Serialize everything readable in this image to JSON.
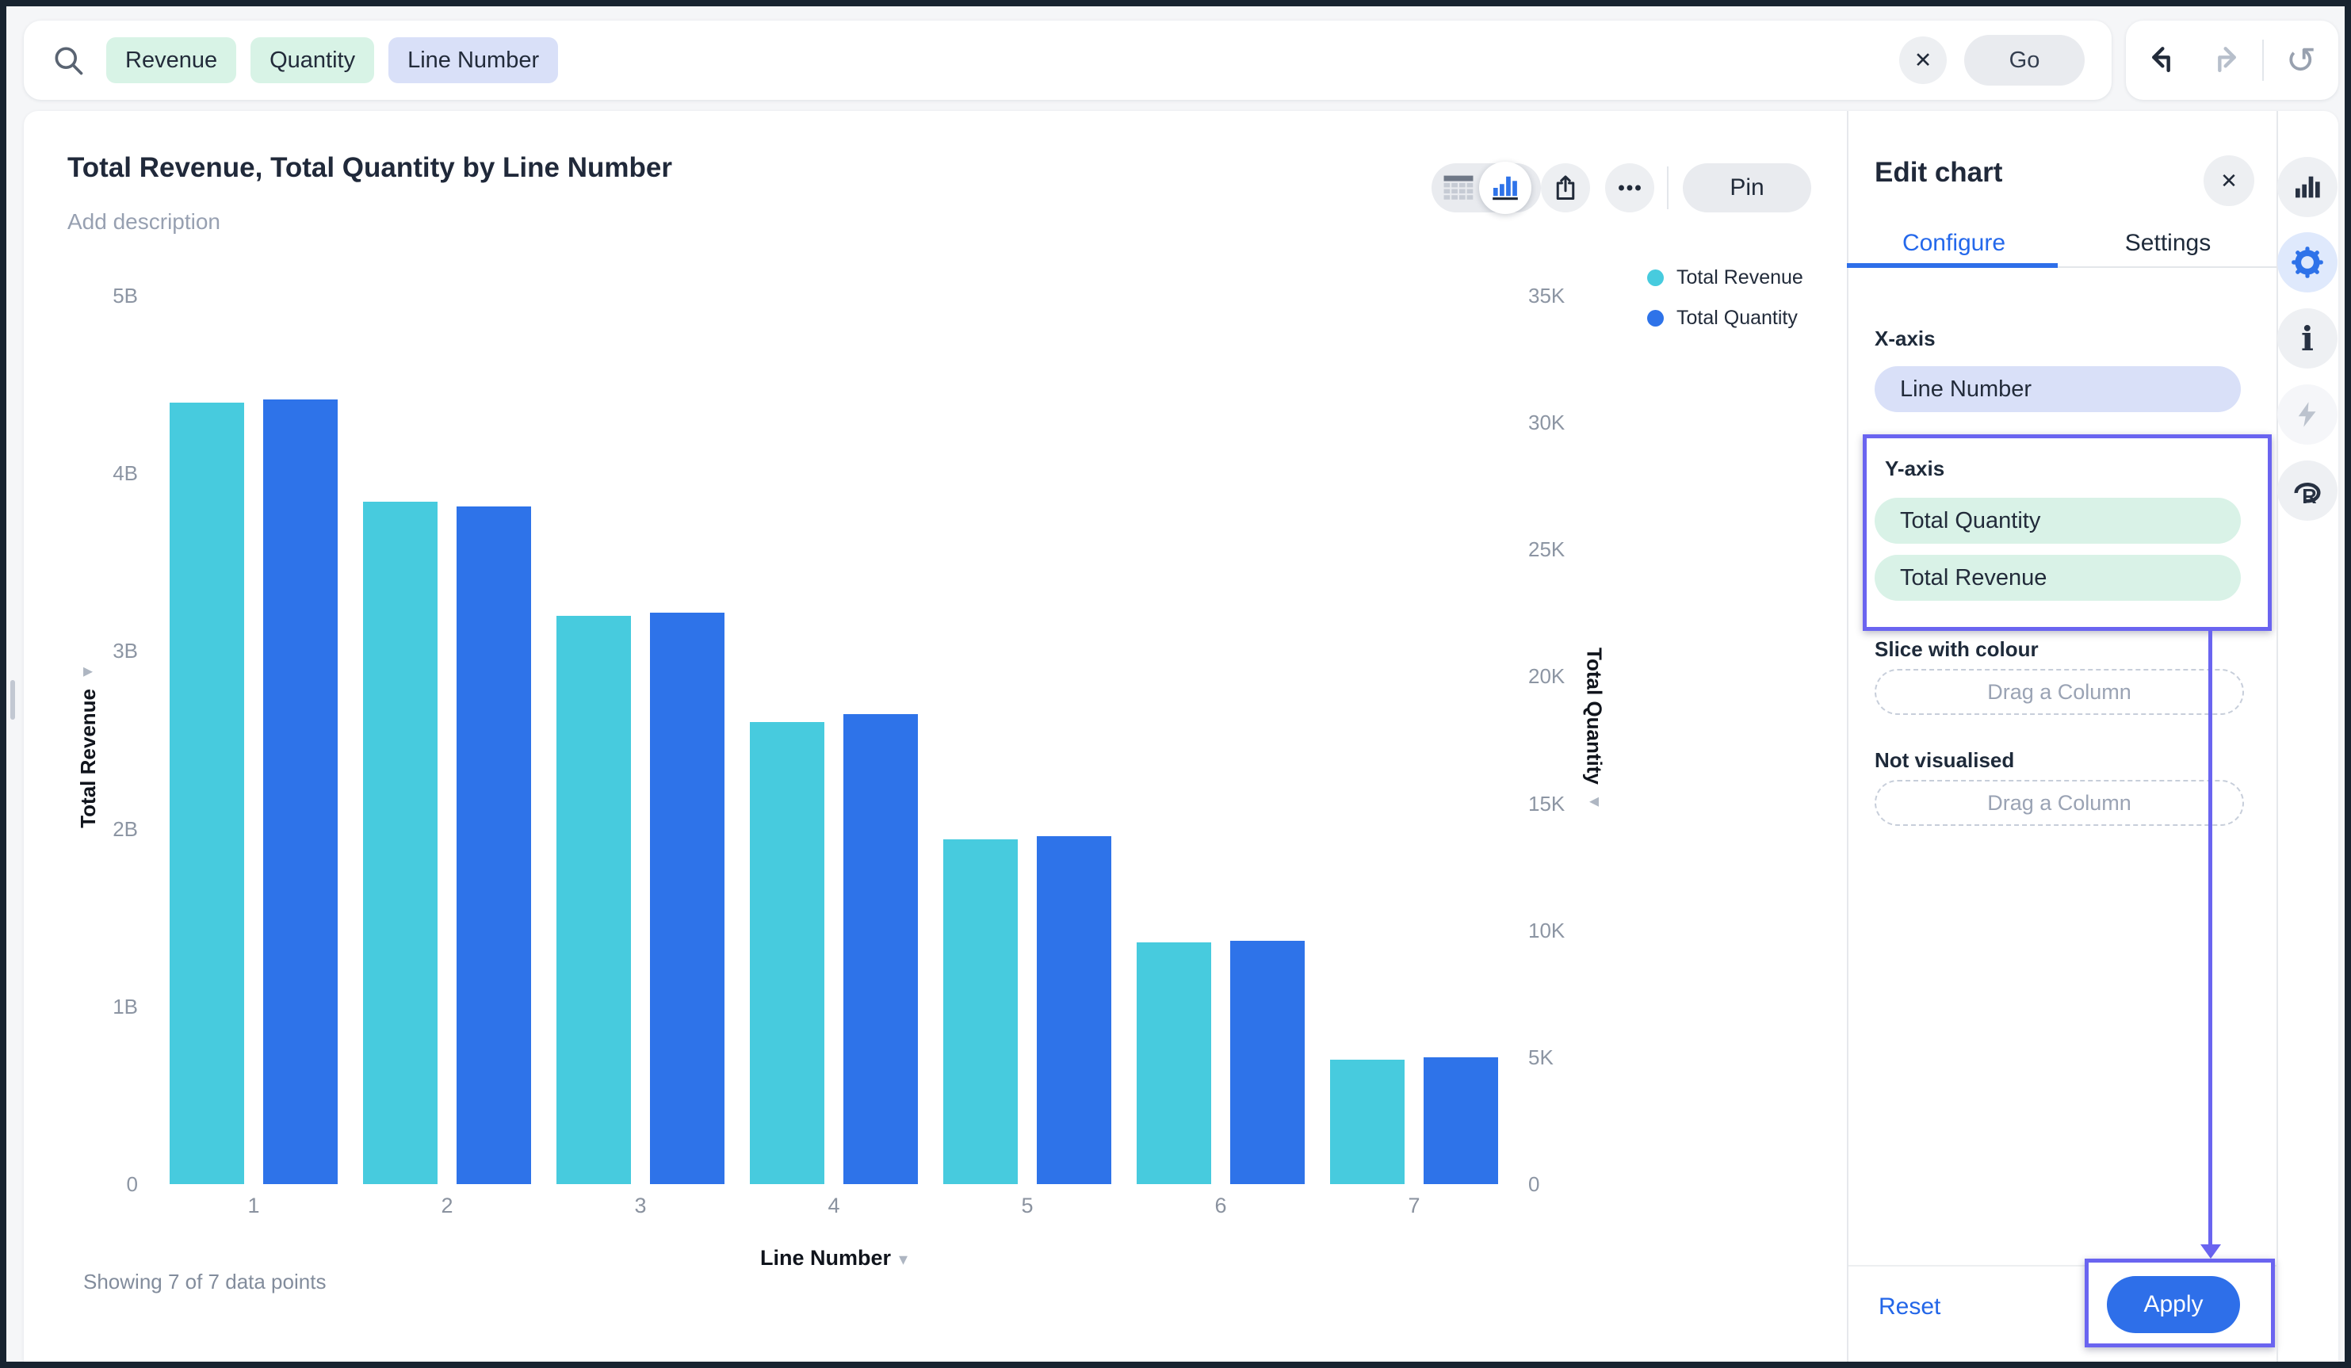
{
  "app": {
    "search": {
      "tokens": [
        {
          "label": "Revenue",
          "kind": "measure"
        },
        {
          "label": "Quantity",
          "kind": "measure"
        },
        {
          "label": "Line Number",
          "kind": "attribute"
        }
      ],
      "clear_label": "✕",
      "go_label": "Go"
    },
    "header": {
      "title": "Total Revenue, Total Quantity by Line Number",
      "description_placeholder": "Add description",
      "pin_label": "Pin"
    },
    "status": {
      "showing": "Showing 7 of 7 data points"
    }
  },
  "chart_data": {
    "type": "bar",
    "title": "Total Revenue, Total Quantity by Line Number",
    "categories": [
      "1",
      "2",
      "3",
      "4",
      "5",
      "6",
      "7"
    ],
    "series": [
      {
        "name": "Total Revenue",
        "axis": "left",
        "unit": "B",
        "color": "#47CBDE",
        "values": [
          4.4,
          3.84,
          3.2,
          2.6,
          1.94,
          1.36,
          0.7
        ]
      },
      {
        "name": "Total Quantity",
        "axis": "right",
        "unit": "K",
        "color": "#2E73E9",
        "values": [
          30.9,
          26.7,
          22.5,
          18.5,
          13.7,
          9.6,
          5.0
        ]
      }
    ],
    "left_axis": {
      "label": "Total Revenue",
      "min": 0,
      "max": 5,
      "ticks": [
        {
          "value": 5,
          "label": "5B"
        },
        {
          "value": 4,
          "label": "4B"
        },
        {
          "value": 3,
          "label": "3B"
        },
        {
          "value": 2,
          "label": "2B"
        },
        {
          "value": 1,
          "label": "1B"
        },
        {
          "value": 0,
          "label": "0"
        }
      ]
    },
    "right_axis": {
      "label": "Total Quantity",
      "min": 0,
      "max": 35,
      "ticks": [
        {
          "value": 35,
          "label": "35K"
        },
        {
          "value": 30,
          "label": "30K"
        },
        {
          "value": 25,
          "label": "25K"
        },
        {
          "value": 20,
          "label": "20K"
        },
        {
          "value": 15,
          "label": "15K"
        },
        {
          "value": 10,
          "label": "10K"
        },
        {
          "value": 5,
          "label": "5K"
        },
        {
          "value": 0,
          "label": "0"
        }
      ]
    },
    "xlabel": "Line Number",
    "legend_position": "top-right",
    "grid": false
  },
  "edit_panel": {
    "title": "Edit chart",
    "tabs": {
      "configure": "Configure",
      "settings": "Settings",
      "active": "Configure"
    },
    "x_axis": {
      "label": "X-axis",
      "field": "Line Number"
    },
    "y_axis": {
      "label": "Y-axis",
      "fields": [
        "Total Quantity",
        "Total Revenue"
      ]
    },
    "slice": {
      "label": "Slice with colour",
      "placeholder": "Drag a Column"
    },
    "not_visualised": {
      "label": "Not visualised",
      "placeholder": "Drag a Column"
    },
    "reset_label": "Reset",
    "apply_label": "Apply"
  },
  "icons": {
    "close": "✕",
    "history": "↺",
    "triangle_down": "▾",
    "triangle_right": "▸",
    "triangle_left": "◂"
  },
  "colors": {
    "accent_blue": "#2E6FE9",
    "annotation_purple": "#6A64F0",
    "bar_revenue": "#47CBDE",
    "bar_quantity": "#2E73E9",
    "token_measure_bg": "#D8F3E6",
    "token_attribute_bg": "#D9E0F8"
  }
}
